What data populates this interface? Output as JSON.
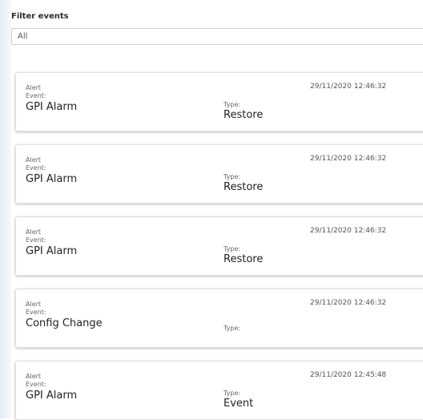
{
  "filter": {
    "label": "Filter events",
    "selected": "All"
  },
  "events": [
    {
      "category": "Alert",
      "timestamp": "29/11/2020 12:46:32",
      "event_label": "Event:",
      "event": "GPI Alarm",
      "type_label": "Type:",
      "type": "Restore"
    },
    {
      "category": "Alert",
      "timestamp": "29/11/2020 12:46:32",
      "event_label": "Event:",
      "event": "GPI Alarm",
      "type_label": "Type:",
      "type": "Restore"
    },
    {
      "category": "Alert",
      "timestamp": "29/11/2020 12:46:32",
      "event_label": "Event:",
      "event": "GPI Alarm",
      "type_label": "Type:",
      "type": "Restore"
    },
    {
      "category": "Alert",
      "timestamp": "29/11/2020 12:46:32",
      "event_label": "Event:",
      "event": "Config Change",
      "type_label": "Type:",
      "type": ""
    },
    {
      "category": "Alert",
      "timestamp": "29/11/2020 12:45:48",
      "event_label": "Event:",
      "event": "GPI Alarm",
      "type_label": "Type:",
      "type": "Event"
    }
  ]
}
